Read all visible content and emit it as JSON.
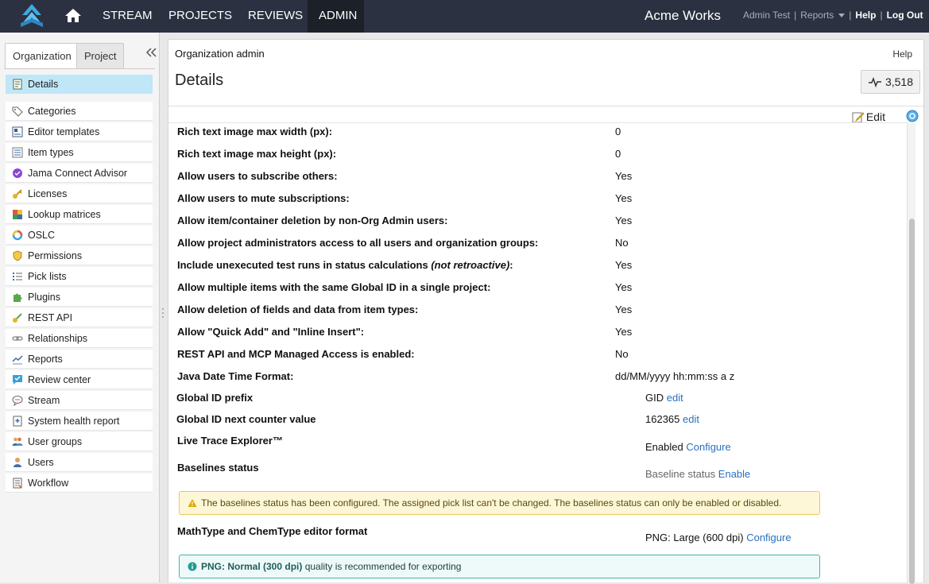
{
  "nav": {
    "items": [
      "STREAM",
      "PROJECTS",
      "REVIEWS",
      "ADMIN"
    ],
    "active": "ADMIN",
    "brand": "Acme Works",
    "user": "Admin Test",
    "reports": "Reports",
    "help": "Help",
    "logout": "Log Out",
    "separator": "|"
  },
  "sidebar": {
    "tabs": [
      "Organization",
      "Project"
    ],
    "active_tab": "Organization",
    "items": [
      {
        "label": "Details",
        "icon": "details-icon"
      },
      {
        "label": "Categories",
        "icon": "tag-icon"
      },
      {
        "label": "Editor templates",
        "icon": "template-icon"
      },
      {
        "label": "Item types",
        "icon": "item-types-icon"
      },
      {
        "label": "Jama Connect Advisor",
        "icon": "advisor-icon"
      },
      {
        "label": "Licenses",
        "icon": "key-icon"
      },
      {
        "label": "Lookup matrices",
        "icon": "matrix-icon"
      },
      {
        "label": "OSLC",
        "icon": "oslc-icon"
      },
      {
        "label": "Permissions",
        "icon": "shield-icon"
      },
      {
        "label": "Pick lists",
        "icon": "list-icon"
      },
      {
        "label": "Plugins",
        "icon": "puzzle-icon"
      },
      {
        "label": "REST API",
        "icon": "api-key-icon"
      },
      {
        "label": "Relationships",
        "icon": "link-icon"
      },
      {
        "label": "Reports",
        "icon": "chart-icon"
      },
      {
        "label": "Review center",
        "icon": "review-icon"
      },
      {
        "label": "Stream",
        "icon": "chat-icon"
      },
      {
        "label": "System health report",
        "icon": "health-icon"
      },
      {
        "label": "User groups",
        "icon": "users-icon"
      },
      {
        "label": "Users",
        "icon": "user-icon"
      },
      {
        "label": "Workflow",
        "icon": "workflow-icon"
      }
    ],
    "active_item": "Details"
  },
  "main": {
    "breadcrumb": "Organization admin",
    "help": "Help",
    "title": "Details",
    "activity_count": "3,518",
    "edit_label": "Edit",
    "settings": [
      {
        "label": "Rich text image max width (px):",
        "value": "0"
      },
      {
        "label": "Rich text image max height (px):",
        "value": "0"
      },
      {
        "label": "Allow users to subscribe others:",
        "value": "Yes"
      },
      {
        "label": "Allow users to mute subscriptions:",
        "value": "Yes"
      },
      {
        "label": "Allow item/container deletion by non-Org Admin users:",
        "value": "Yes"
      },
      {
        "label": "Allow project administrators access to all users and organization groups:",
        "value": "No"
      },
      {
        "label": "Include unexecuted test runs in status calculations ",
        "note": "(not retroactive)",
        "suffix": ":",
        "value": "Yes"
      },
      {
        "label": "Allow multiple items with the same Global ID in a single project:",
        "value": "Yes"
      },
      {
        "label": "Allow deletion of fields and data from item types:",
        "value": "Yes"
      },
      {
        "label": "Allow \"Quick Add\" and \"Inline Insert\":",
        "value": "Yes"
      },
      {
        "label": "REST API and MCP Managed Access is enabled:",
        "value": "No"
      },
      {
        "label": "Java Date Time Format:",
        "value": "dd/MM/yyyy hh:mm:ss a z"
      }
    ],
    "global_id_prefix": {
      "label": "Global ID prefix",
      "value": "GID",
      "action": "edit"
    },
    "global_id_counter": {
      "label": "Global ID next counter value",
      "value": "162365",
      "action": "edit"
    },
    "live_trace": {
      "label": "Live Trace Explorer™",
      "value": "Enabled",
      "action": "Configure"
    },
    "baselines": {
      "label": "Baselines status",
      "value": "Baseline status",
      "action": "Enable"
    },
    "baselines_warning": "The baselines status has been configured. The assigned pick list can't be changed. The baselines status can only be enabled or disabled.",
    "mathtype": {
      "label": "MathType and ChemType editor format",
      "value": "PNG: Large (600 dpi)",
      "action": "Configure"
    },
    "mathtype_info": {
      "bold": "PNG: Normal (300 dpi)",
      "rest": " quality is recommended for exporting"
    }
  },
  "colors": {
    "topbar": "#2b3140",
    "active_nav": "#1c2029",
    "active_sidebar": "#bfe7f8",
    "link": "#2b6fc1",
    "warning_bg": "#fdf7d8",
    "info_border": "#3fb7ad"
  }
}
